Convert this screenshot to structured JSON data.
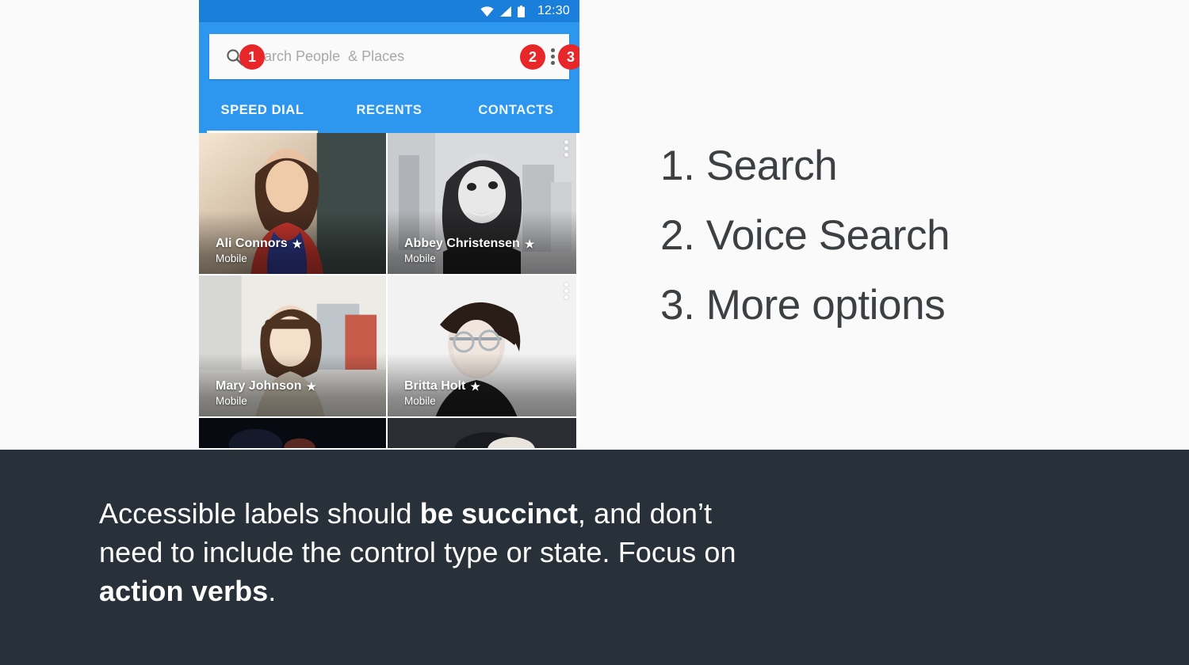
{
  "colors": {
    "page_background": "#FAFAFA",
    "statusbar_blue": "#1A7EDB",
    "appbar_blue": "#2D96EE",
    "badge_red": "#E8272B",
    "footer_dark": "#28313A",
    "callout_text": "#3C4043"
  },
  "phone": {
    "statusbar": {
      "time": "12:30",
      "icons": [
        "wifi-icon",
        "signal-icon",
        "battery-icon"
      ]
    },
    "search": {
      "search_icon": "search-icon",
      "placeholder": "Search People  & Places",
      "value": "",
      "mic_icon": "microphone-icon",
      "overflow_icon": "more-options-icon"
    },
    "badges": [
      {
        "number": "1",
        "target": "search-icon"
      },
      {
        "number": "2",
        "target": "microphone-icon"
      },
      {
        "number": "3",
        "target": "more-options-icon"
      }
    ],
    "tabs": [
      {
        "label": "SPEED DIAL",
        "active": true
      },
      {
        "label": "RECENTS",
        "active": false
      },
      {
        "label": "CONTACTS",
        "active": false
      }
    ],
    "contacts": [
      {
        "name": "Ali Connors",
        "starred": "★",
        "label": "Mobile",
        "has_overflow": false
      },
      {
        "name": "Abbey Christensen",
        "starred": "★",
        "label": "Mobile",
        "has_overflow": true
      },
      {
        "name": "Mary Johnson",
        "starred": "★",
        "label": "Mobile",
        "has_overflow": false
      },
      {
        "name": "Britta Holt",
        "starred": "★",
        "label": "Mobile",
        "has_overflow": true
      }
    ]
  },
  "callouts": [
    "1. Search",
    "2. Voice Search",
    "3. More options"
  ],
  "caption": {
    "part1": "Accessible labels should ",
    "bold1": "be succinct",
    "part2": ", and don’t need to include the control type or state. Focus on ",
    "bold2": "action verbs",
    "part3": "."
  }
}
